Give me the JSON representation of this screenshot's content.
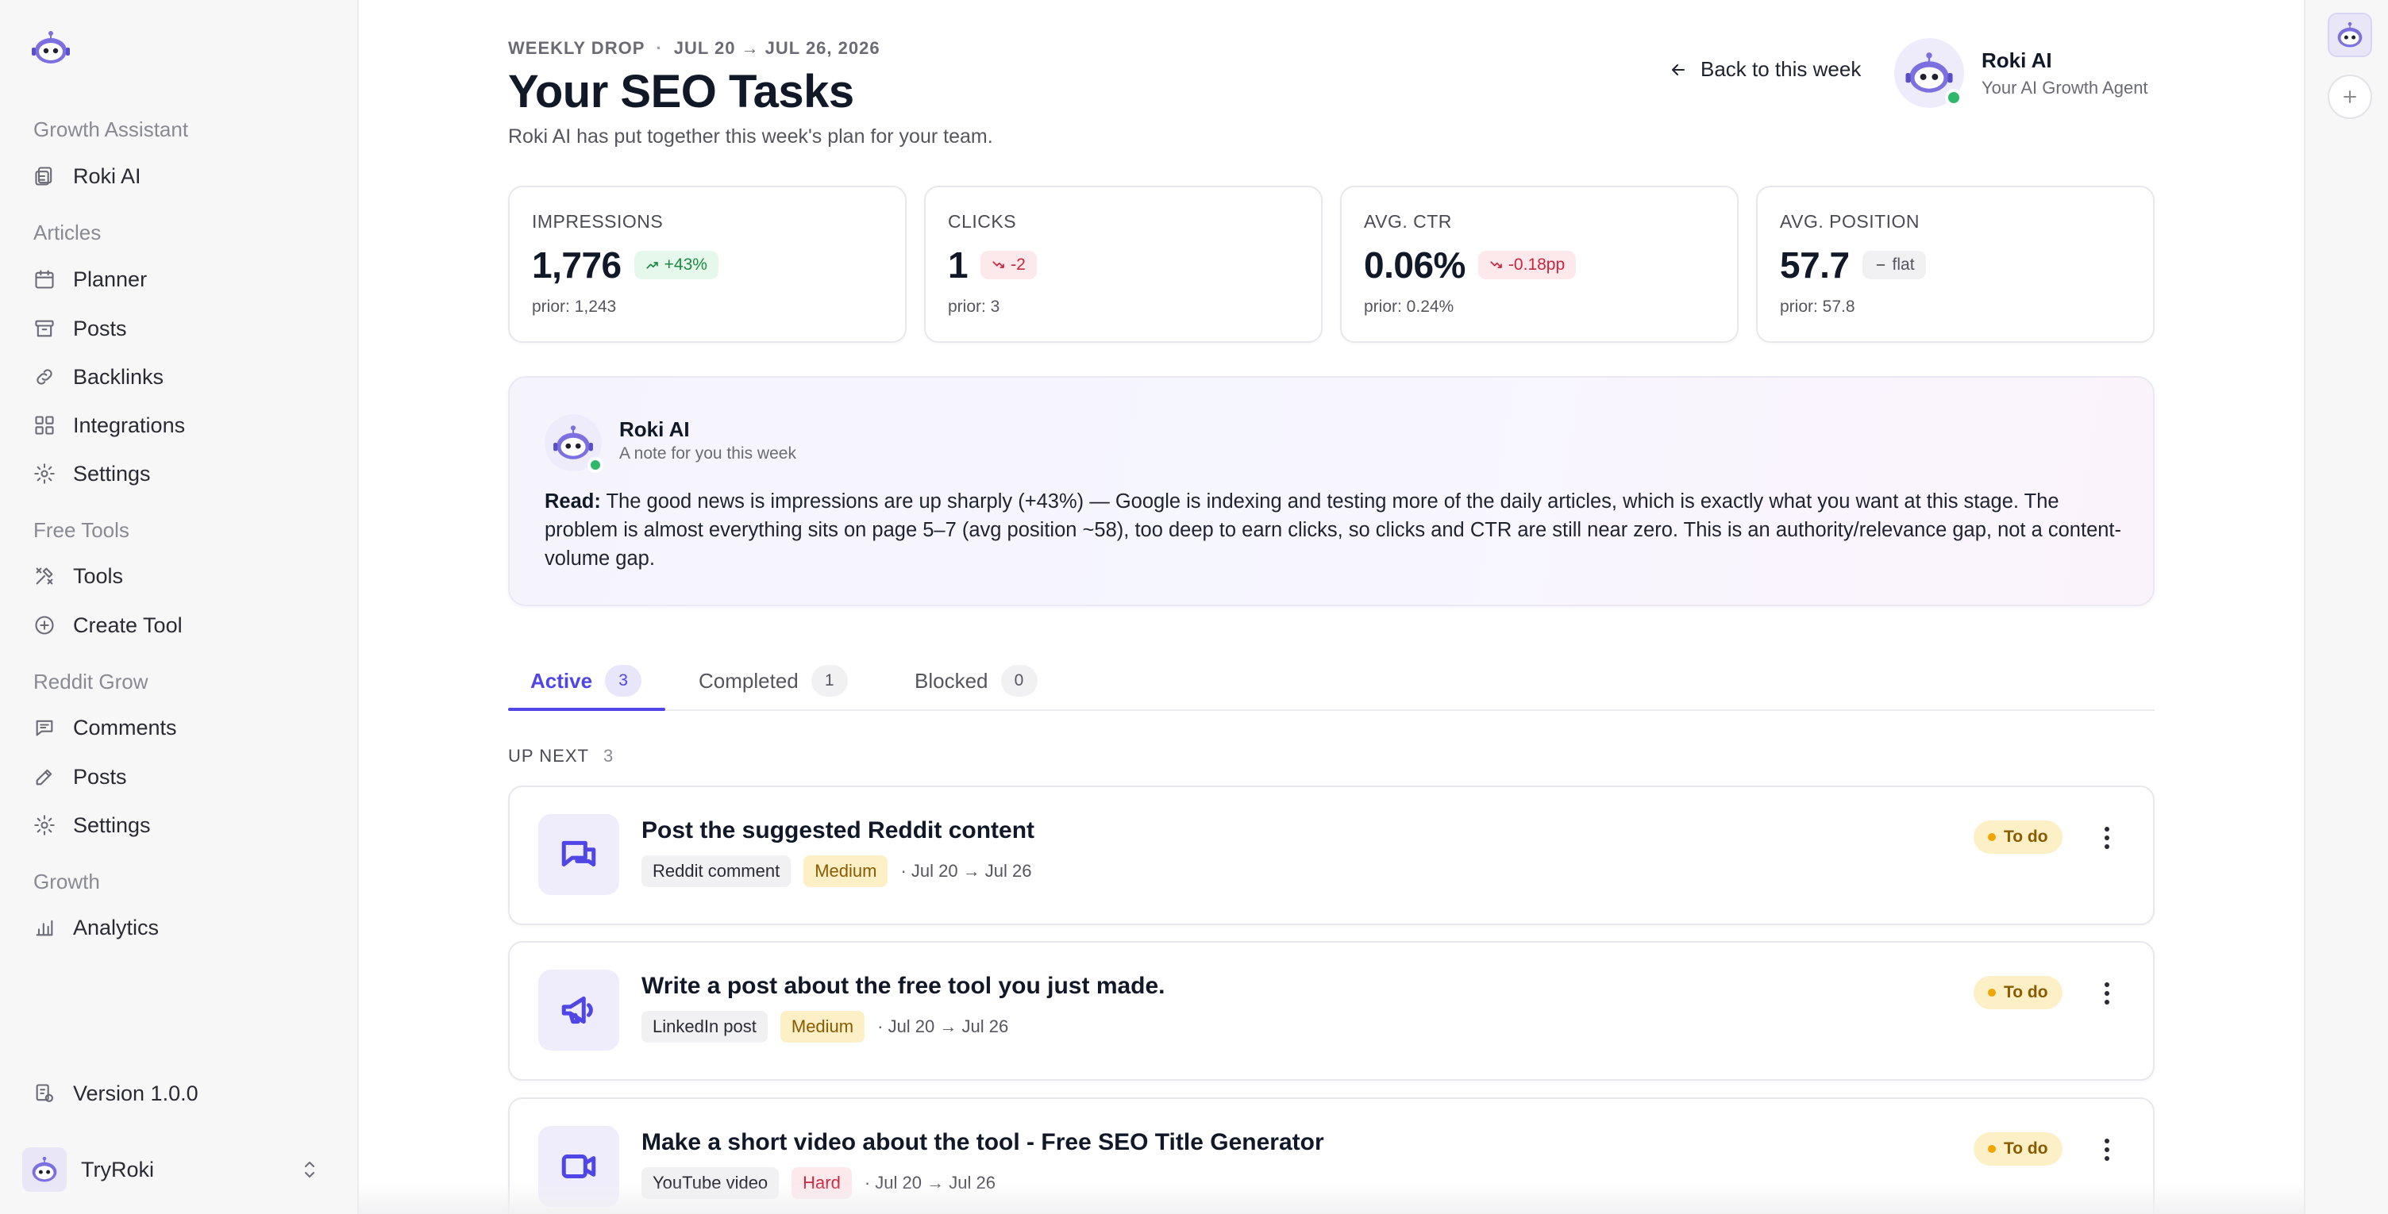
{
  "sidebar": {
    "groups": [
      {
        "label": "Growth Assistant",
        "items": [
          {
            "label": "Roki AI",
            "icon": "robot-doc-icon"
          }
        ]
      },
      {
        "label": "Articles",
        "items": [
          {
            "label": "Planner",
            "icon": "calendar-icon"
          },
          {
            "label": "Posts",
            "icon": "archive-icon"
          },
          {
            "label": "Backlinks",
            "icon": "link-icon"
          },
          {
            "label": "Integrations",
            "icon": "grid-icon"
          },
          {
            "label": "Settings",
            "icon": "gear-icon"
          }
        ]
      },
      {
        "label": "Free Tools",
        "items": [
          {
            "label": "Tools",
            "icon": "tools-icon"
          },
          {
            "label": "Create Tool",
            "icon": "plus-circle-icon"
          }
        ]
      },
      {
        "label": "Reddit Grow",
        "items": [
          {
            "label": "Comments",
            "icon": "chat-icon"
          },
          {
            "label": "Posts",
            "icon": "pencil-icon"
          },
          {
            "label": "Settings",
            "icon": "gear-icon"
          }
        ]
      },
      {
        "label": "Growth",
        "items": [
          {
            "label": "Analytics",
            "icon": "bar-chart-icon"
          }
        ]
      }
    ],
    "version": "Version 1.0.0",
    "workspace": "TryRoki"
  },
  "header": {
    "eyebrow_left": "WEEKLY DROP",
    "eyebrow_right": "JUL 20 → JUL 26, 2026",
    "title": "Your SEO Tasks",
    "subtitle": "Roki AI has put together this week's plan for your team.",
    "back_label": "Back to this week",
    "agent_name": "Roki AI",
    "agent_role": "Your AI Growth Agent"
  },
  "stats": [
    {
      "label": "IMPRESSIONS",
      "value": "1,776",
      "delta": "+43%",
      "trend": "up",
      "prior": "prior: 1,243"
    },
    {
      "label": "CLICKS",
      "value": "1",
      "delta": "-2",
      "trend": "down",
      "prior": "prior: 3"
    },
    {
      "label": "AVG. CTR",
      "value": "0.06%",
      "delta": "-0.18pp",
      "trend": "down",
      "prior": "prior: 0.24%"
    },
    {
      "label": "AVG. POSITION",
      "value": "57.7",
      "delta": "flat",
      "trend": "flat",
      "prior": "prior: 57.8"
    }
  ],
  "note": {
    "name": "Roki AI",
    "subtitle": "A note for you this week",
    "lead": "Read:",
    "body": "The good news is impressions are up sharply (+43%) — Google is indexing and testing more of the daily articles, which is exactly what you want at this stage. The problem is almost everything sits on page 5–7 (avg position ~58), too deep to earn clicks, so clicks and CTR are still near zero. This is an authority/relevance gap, not a content-volume gap."
  },
  "tabs": [
    {
      "label": "Active",
      "count": "3"
    },
    {
      "label": "Completed",
      "count": "1"
    },
    {
      "label": "Blocked",
      "count": "0"
    }
  ],
  "section": {
    "label": "UP NEXT",
    "count": "3"
  },
  "tasks": [
    {
      "title": "Post the suggested Reddit content",
      "type": "Reddit comment",
      "difficulty": "Medium",
      "dates": "· Jul 20 → Jul 26",
      "status": "To do",
      "icon": "chat-bubbles-icon"
    },
    {
      "title": "Write a post about the free tool you just made.",
      "type": "LinkedIn post",
      "difficulty": "Medium",
      "dates": "· Jul 20 → Jul 26",
      "status": "To do",
      "icon": "megaphone-icon"
    },
    {
      "title": "Make a short video about the tool - Free SEO Title Generator",
      "type": "YouTube video",
      "difficulty": "Hard",
      "dates": "· Jul 20 → Jul 26",
      "status": "To do",
      "icon": "video-camera-icon"
    }
  ],
  "colors": {
    "accent": "#4f46e5",
    "positive": "#1c8a45",
    "negative": "#c8263f",
    "warning_bg": "#fdf0c7",
    "online": "#2fb86b"
  }
}
